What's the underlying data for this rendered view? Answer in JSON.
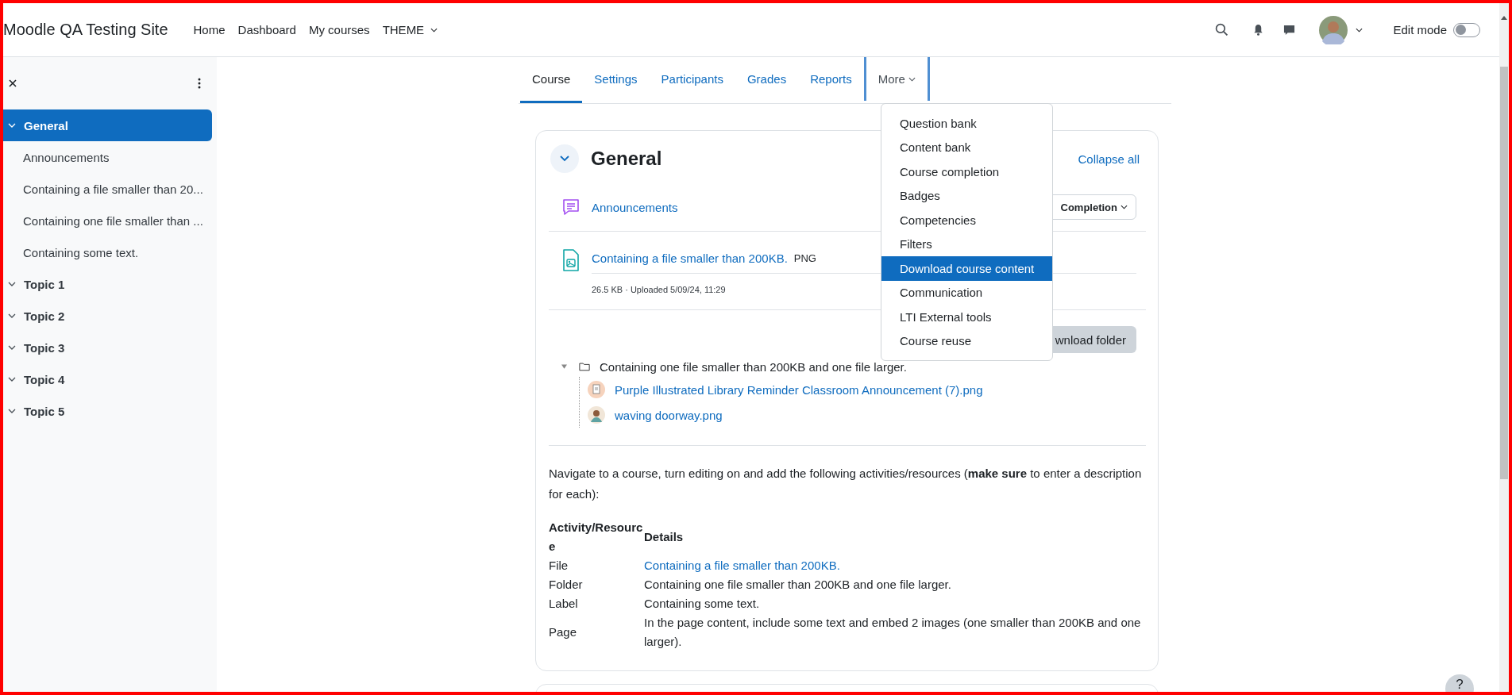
{
  "site_name": "Moodle QA Testing Site",
  "nav": [
    {
      "label": "Home",
      "kind": "link"
    },
    {
      "label": "Dashboard",
      "kind": "link"
    },
    {
      "label": "My courses",
      "kind": "link"
    },
    {
      "label": "THEME",
      "kind": "menu"
    }
  ],
  "edit_mode": {
    "label": "Edit mode",
    "on": false
  },
  "sidebar": {
    "items": [
      {
        "label": "General",
        "selected": true,
        "children": [
          {
            "label": "Announcements"
          },
          {
            "label": "Containing a file smaller than 20..."
          },
          {
            "label": "Containing one file smaller than ..."
          },
          {
            "label": "Containing some text."
          }
        ]
      },
      {
        "label": "Topic 1",
        "selected": false
      },
      {
        "label": "Topic 2",
        "selected": false
      },
      {
        "label": "Topic 3",
        "selected": false
      },
      {
        "label": "Topic 4",
        "selected": false
      },
      {
        "label": "Topic 5",
        "selected": false
      }
    ]
  },
  "course_tabs": [
    {
      "label": "Course",
      "selected": true,
      "kind": "link",
      "focused": false
    },
    {
      "label": "Settings",
      "selected": false,
      "kind": "link",
      "focused": false
    },
    {
      "label": "Participants",
      "selected": false,
      "kind": "link",
      "focused": false
    },
    {
      "label": "Grades",
      "selected": false,
      "kind": "link",
      "focused": false
    },
    {
      "label": "Reports",
      "selected": false,
      "kind": "link",
      "focused": false
    },
    {
      "label": "More",
      "selected": false,
      "kind": "menu",
      "focused": true
    }
  ],
  "more_menu": {
    "items": [
      {
        "label": "Question bank",
        "selected": false
      },
      {
        "label": "Content bank",
        "selected": false
      },
      {
        "label": "Course completion",
        "selected": false
      },
      {
        "label": "Badges",
        "selected": false
      },
      {
        "label": "Competencies",
        "selected": false
      },
      {
        "label": "Filters",
        "selected": false
      },
      {
        "label": "Download course content",
        "selected": true
      },
      {
        "label": "Communication",
        "selected": false
      },
      {
        "label": "LTI External tools",
        "selected": false
      },
      {
        "label": "Course reuse",
        "selected": false
      }
    ]
  },
  "section": {
    "title": "General",
    "expanded": true,
    "collapse_label": "Collapse all",
    "activities": [
      {
        "kind": "forum",
        "title": "Announcements",
        "completion_label": "Completion"
      },
      {
        "kind": "file",
        "title": "Containing a file smaller than 200KB.",
        "type_label": "PNG",
        "meta": "26.5 KB · Uploaded 5/09/24, 11:29"
      },
      {
        "kind": "folder",
        "button": "wnload folder",
        "title": "Containing one file smaller than 200KB and one file larger.",
        "expanded": true,
        "files": [
          {
            "name": "Purple Illustrated Library Reminder Classroom Announcement (7).png"
          },
          {
            "name": "waving doorway.png"
          }
        ]
      },
      {
        "kind": "label",
        "text": "Navigate to a course, turn editing on and add the following activities/resources (**make sure** to enter a description for each):",
        "table": {
          "columns": [
            "Activity/Resource",
            "Details"
          ],
          "rows": [
            {
              "cells": [
                "File",
                "Containing a file smaller than 200KB."
              ],
              "link": true
            },
            {
              "cells": [
                "Folder",
                "Containing one file smaller than 200KB and one file larger."
              ],
              "link": false
            },
            {
              "cells": [
                "Label",
                "Containing some text."
              ],
              "link": false
            },
            {
              "cells": [
                "Page",
                "In the page content, include some text and embed 2 images (one smaller than 200KB and one larger)."
              ],
              "link": false
            }
          ]
        }
      }
    ]
  },
  "help_label": "?"
}
